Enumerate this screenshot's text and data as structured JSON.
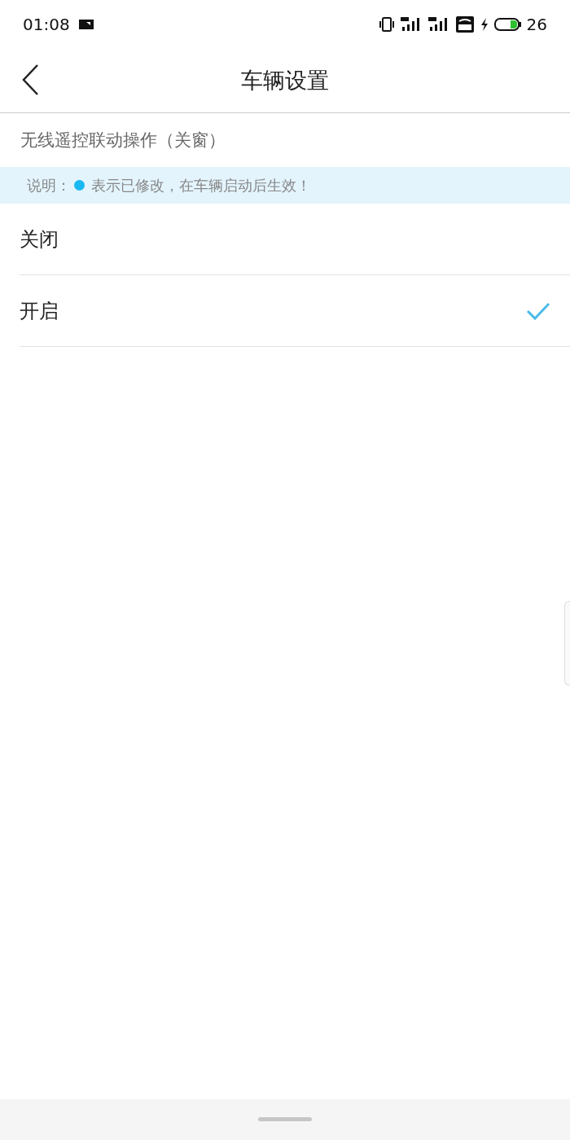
{
  "status_bar": {
    "time": "01:08",
    "battery": "26"
  },
  "header": {
    "title": "车辆设置"
  },
  "section": {
    "title": "无线遥控联动操作（关窗）"
  },
  "note": {
    "label": "说明：",
    "text": "表示已修改，在车辆启动后生效！"
  },
  "options": [
    {
      "label": "关闭",
      "selected": false
    },
    {
      "label": "开启",
      "selected": true
    }
  ]
}
